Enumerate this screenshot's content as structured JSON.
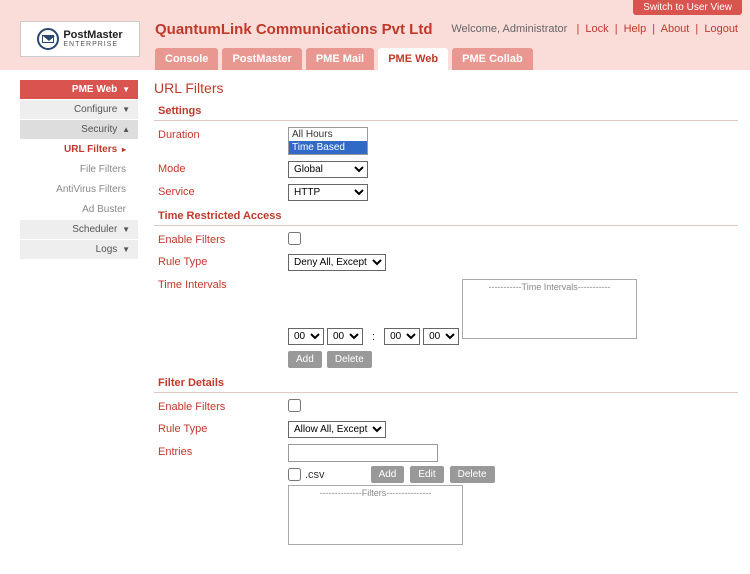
{
  "topbar": {
    "switch_user": "Switch to User View"
  },
  "logo": {
    "main": "PostMaster",
    "sub": "ENTERPRISE"
  },
  "company_name": "QuantumLink Communications Pvt Ltd",
  "welcome": {
    "prefix": "Welcome, ",
    "role": "Administrator",
    "lock": "Lock",
    "help": "Help",
    "about": "About",
    "logout": "Logout"
  },
  "tabs": [
    "Console",
    "PostMaster",
    "PME Mail",
    "PME Web",
    "PME Collab"
  ],
  "tabs_active_index": 3,
  "sidebar": {
    "main": "PME Web",
    "group1": "Configure",
    "group2": "Security",
    "sub": [
      "URL Filters",
      "File Filters",
      "AntiVirus Filters",
      "Ad Buster"
    ],
    "sub_active_index": 0,
    "group3": "Scheduler",
    "group4": "Logs"
  },
  "page": {
    "title": "URL Filters",
    "sections": {
      "settings": "Settings",
      "time_restricted": "Time Restricted Access",
      "filter_details": "Filter Details"
    },
    "labels": {
      "duration": "Duration",
      "mode": "Mode",
      "service": "Service",
      "enable_filters": "Enable Filters",
      "rule_type": "Rule Type",
      "time_intervals": "Time Intervals",
      "entries": "Entries"
    },
    "duration_options": [
      "All Hours",
      "Time Based"
    ],
    "duration_selected_index": 1,
    "mode_value": "Global",
    "service_value": "HTTP",
    "rule_type_time": "Deny All, Except",
    "rule_type_filter": "Allow All, Except",
    "time_sel": "00",
    "time_box_placeholder": "-----------Time Intervals-----------",
    "filter_box_placeholder": "--------------Filters---------------",
    "csv_label": ".csv",
    "buttons": {
      "add": "Add",
      "delete": "Delete",
      "edit": "Edit"
    }
  }
}
